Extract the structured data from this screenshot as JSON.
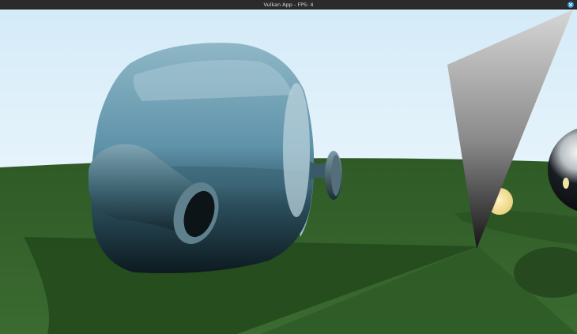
{
  "window": {
    "title": "Vulkan App - FPS: 4",
    "close_icon": "close-icon"
  },
  "colors": {
    "titlebar": "#2b2b2b",
    "close_button": "#2f8fd8",
    "sky_top": "#cfe7f6",
    "ground": "#35632c",
    "teapot_body": "#6f9fb4",
    "sphere": "#101418",
    "light_ball": "#f3df95"
  }
}
